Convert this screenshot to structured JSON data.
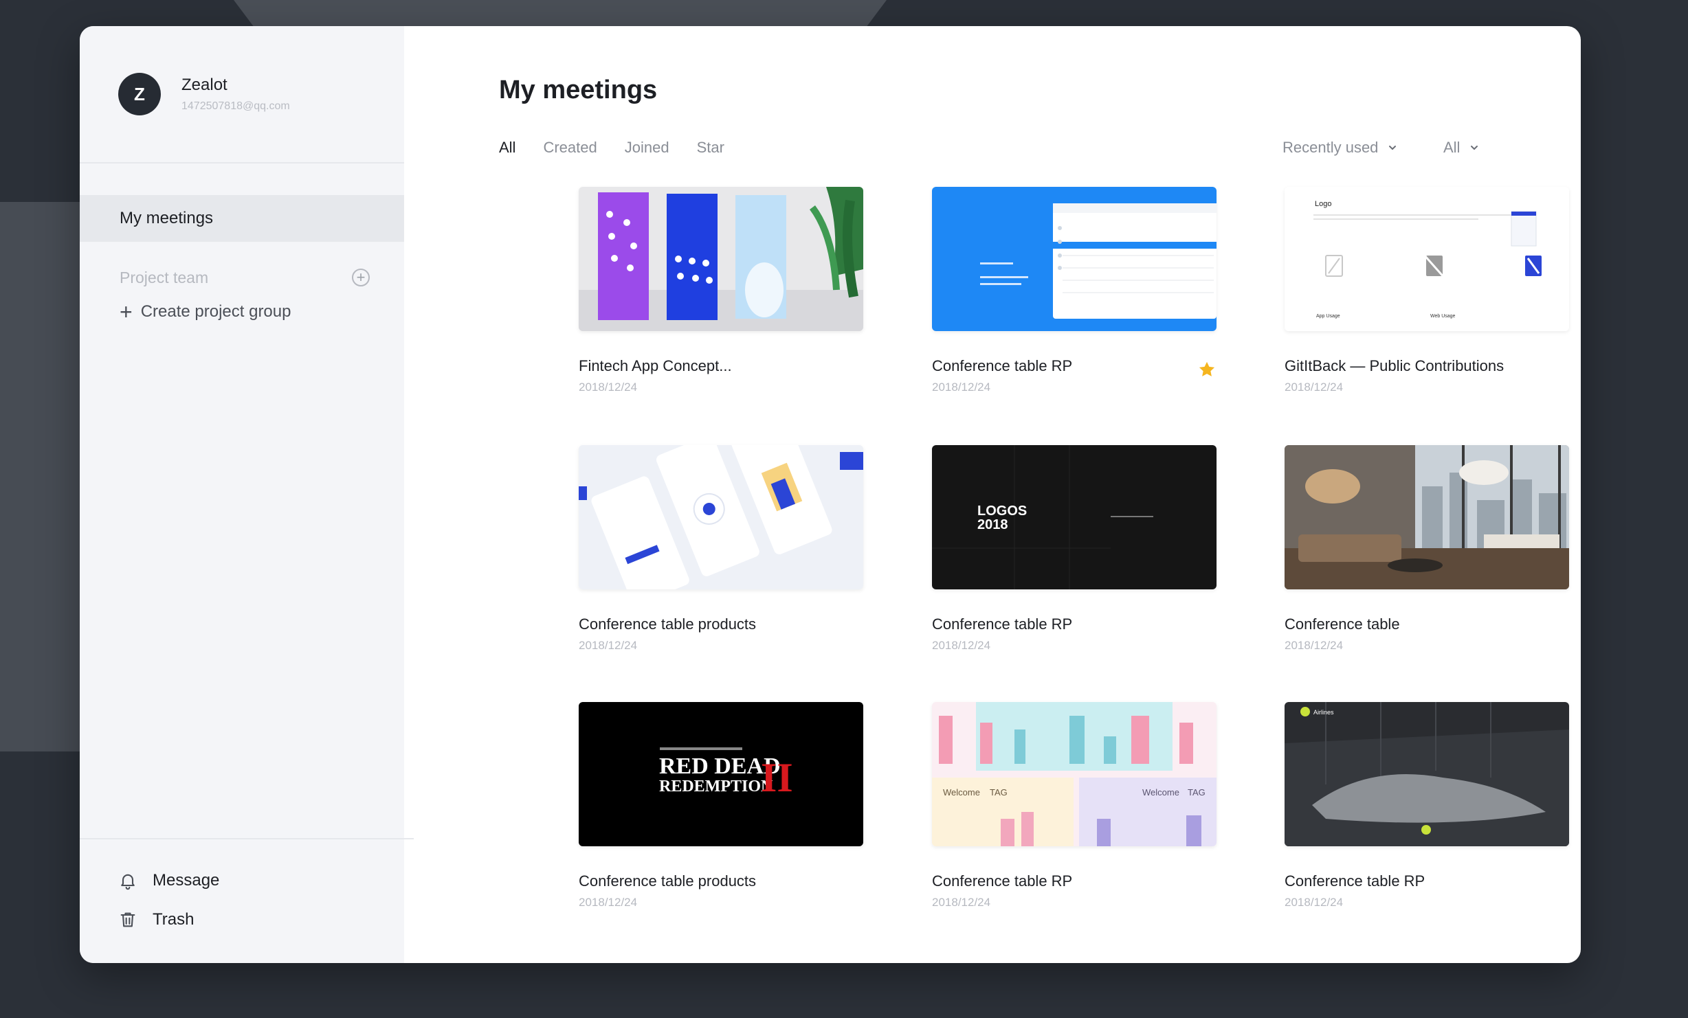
{
  "user": {
    "initial": "Z",
    "name": "Zealot",
    "email": "1472507818@qq.com"
  },
  "sidebar": {
    "my_meetings": "My meetings",
    "project_team": "Project team",
    "create_group": "Create project group",
    "message": "Message",
    "trash": "Trash"
  },
  "main": {
    "title": "My meetings",
    "tabs": [
      "All",
      "Created",
      "Joined",
      "Star"
    ],
    "sort_label": "Recently used",
    "filter_label": "All"
  },
  "thumb_text": {
    "logo": "Logo",
    "app_usage": "App Usage",
    "web_usage": "Web Usage",
    "logos": "LOGOS",
    "year": "2018",
    "rdr_red_dead": "RED DEAD",
    "rdr_redemption": "REDEMPTION",
    "rdr_ii": "II",
    "welcome_1": "Welcome",
    "welcome_tag_1": "TAG",
    "welcome_2": "Welcome",
    "welcome_tag_2": "TAG",
    "airlines": "Airlines"
  },
  "cards": [
    {
      "title": "Fintech App Concept...",
      "date": "2018/12/24",
      "starred": false
    },
    {
      "title": "Conference table RP",
      "date": "2018/12/24",
      "starred": true
    },
    {
      "title": "GitItBack — Public Contributions",
      "date": "2018/12/24",
      "starred": false
    },
    {
      "title": "Conference table products",
      "date": "2018/12/24",
      "starred": false
    },
    {
      "title": "Conference table RP",
      "date": "2018/12/24",
      "starred": false
    },
    {
      "title": "Conference table",
      "date": "2018/12/24",
      "starred": false
    },
    {
      "title": "Conference table products",
      "date": "2018/12/24",
      "starred": false
    },
    {
      "title": "Conference table RP",
      "date": "2018/12/24",
      "starred": false
    },
    {
      "title": "Conference table RP",
      "date": "2018/12/24",
      "starred": false
    }
  ],
  "colors": {
    "accent": "#5bbfcb",
    "star": "#f5b51f",
    "blue": "#1e88f5"
  }
}
